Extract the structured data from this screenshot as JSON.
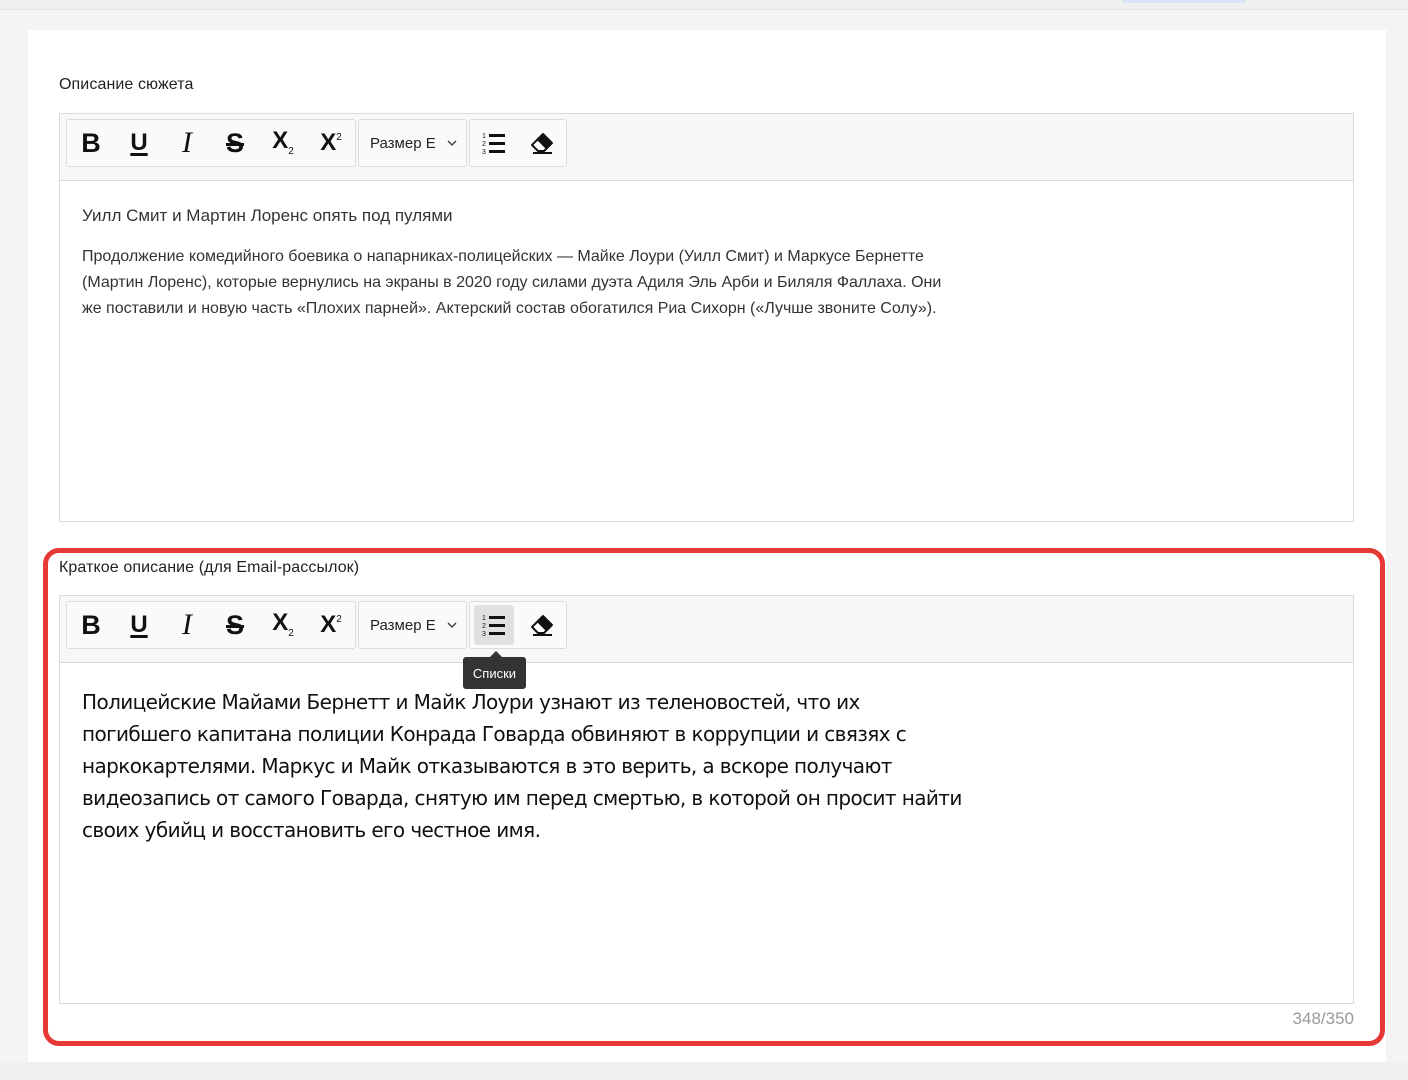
{
  "plot_description": {
    "label": "Описание сюжета",
    "toolbar": {
      "bold": "B",
      "underline": "U",
      "italic": "I",
      "strikethrough": "S",
      "subscript": "X",
      "subscript_index": "2",
      "superscript": "X",
      "superscript_index": "2",
      "size_select": "Размер Е"
    },
    "title": "Уилл Смит и Мартин Лоренс опять под пулями",
    "body": "Продолжение комедийного боевика о напарниках-полицейских — Майке Лоури (Уилл Смит) и Маркусе Бернетте (Мартин Лоренс), которые вернулись на экраны в 2020 году силами дуэта Адиля Эль Арби и Биляля Фаллаха. Они же поставили и новую часть «Плохих парней». Актерский состав обогатился Риа Сихорн («Лучше звоните Солу»)."
  },
  "short_description": {
    "label": "Краткое описание (для Email-рассылок)",
    "toolbar": {
      "bold": "B",
      "underline": "U",
      "italic": "I",
      "strikethrough": "S",
      "subscript": "X",
      "subscript_index": "2",
      "superscript": "X",
      "superscript_index": "2",
      "size_select": "Размер Е"
    },
    "tooltip": "Списки",
    "body": "Полицейские Майами Бернетт и Майк Лоури узнают из теленовостей, что их погибшего капитана полиции Конрада Говарда обвиняют в коррупции и связях с наркокартелями. Маркус и Майк отказываются в это верить, а вскоре получают видеозапись от самого Говарда, снятую им перед смертью, в которой он просит найти своих убийц и восстановить его честное имя.",
    "counter": "348/350"
  },
  "icons": {
    "list": "ordered-list-icon",
    "clear": "eraser-icon",
    "dropdown": "chevron-down-icon"
  },
  "colors": {
    "highlight": "#e53935",
    "tooltip_bg": "#333333",
    "toolbar_bg": "#f7f7f7",
    "active_button": "#e0e0e0",
    "counter": "#999999"
  }
}
